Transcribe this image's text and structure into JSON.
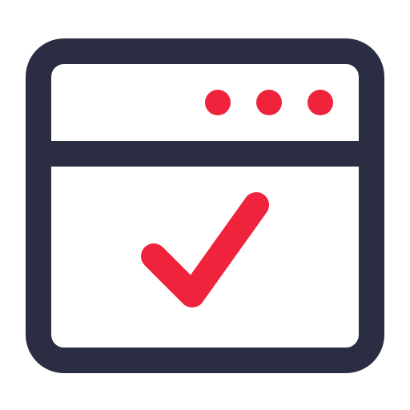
{
  "icon": {
    "name": "browser-window-check-icon",
    "colors": {
      "outline": "#2b2d42",
      "accent": "#ef233c",
      "background": "#ffffff"
    },
    "title_bar": {
      "dots": [
        "dot-1",
        "dot-2",
        "dot-3"
      ]
    },
    "content": {
      "symbol": "checkmark-icon"
    }
  }
}
